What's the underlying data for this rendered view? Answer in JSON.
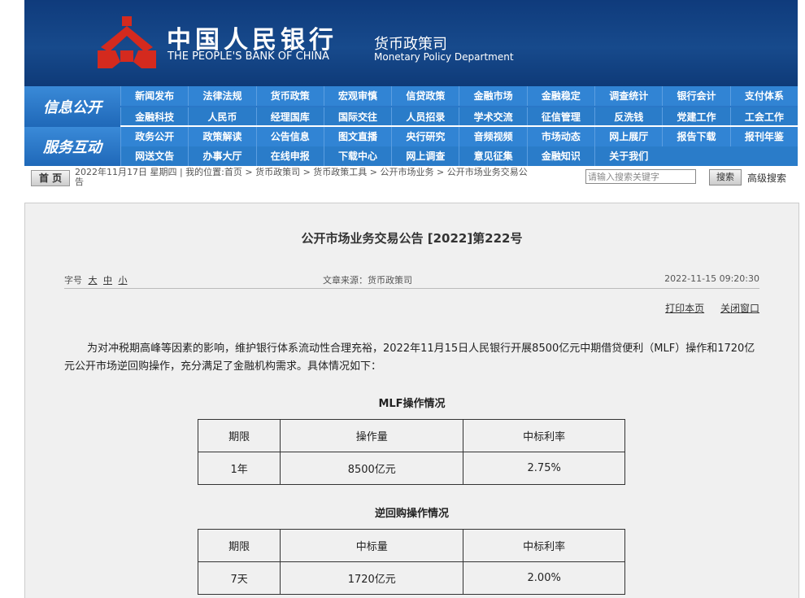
{
  "header": {
    "bank_name_cn": "中国人民银行",
    "bank_name_en": "THE PEOPLE'S BANK OF CHINA",
    "dept_cn": "货币政策司",
    "dept_en": "Monetary Policy Department"
  },
  "nav": {
    "section1_label": "信息公开",
    "section2_label": "服务互动",
    "row1": [
      "新闻发布",
      "法律法规",
      "货币政策",
      "宏观审慎",
      "信贷政策",
      "金融市场",
      "金融稳定",
      "调查统计",
      "银行会计",
      "支付体系"
    ],
    "row2": [
      "金融科技",
      "人民币",
      "经理国库",
      "国际交往",
      "人员招录",
      "学术交流",
      "征信管理",
      "反洗钱",
      "党建工作",
      "工会工作"
    ],
    "row3": [
      "政务公开",
      "政策解读",
      "公告信息",
      "图文直播",
      "央行研究",
      "音频视频",
      "市场动态",
      "网上展厅",
      "报告下载",
      "报刊年鉴"
    ],
    "row4": [
      "网送文告",
      "办事大厅",
      "在线申报",
      "下载中心",
      "网上调查",
      "意见征集",
      "金融知识",
      "关于我们"
    ]
  },
  "breadcrumb": {
    "home_label": "首 页",
    "text": "2022年11月17日 星期四 | 我的位置:首页 > 货币政策司 > 货币政策工具 > 公开市场业务 > 公开市场业务交易公告",
    "search_placeholder": "请输入搜索关键字",
    "search_button": "搜索",
    "advanced_search": "高级搜索"
  },
  "article": {
    "title": "公开市场业务交易公告 [2022]第222号",
    "font_size_label": "字号",
    "font_sizes": [
      "大",
      "中",
      "小"
    ],
    "source": "文章来源：货币政策司",
    "datetime": "2022-11-15 09:20:30",
    "print_label": "打印本页",
    "close_label": "关闭窗口",
    "paragraph": "为对冲税期高峰等因素的影响，维护银行体系流动性合理充裕，2022年11月15日人民银行开展8500亿元中期借贷便利（MLF）操作和1720亿元公开市场逆回购操作，充分满足了金融机构需求。具体情况如下：",
    "mlf_heading": "MLF操作情况",
    "mlf_table": {
      "headers": [
        "期限",
        "操作量",
        "中标利率"
      ],
      "row": [
        "1年",
        "8500亿元",
        "2.75%"
      ]
    },
    "repo_heading": "逆回购操作情况",
    "repo_table": {
      "headers": [
        "期限",
        "中标量",
        "中标利率"
      ],
      "row": [
        "7天",
        "1720亿元",
        "2.00%"
      ]
    }
  },
  "colors": {
    "banner": "#174a8c",
    "nav": "#2a78c8",
    "logo": "#d42a1e",
    "panel": "#f0f0f0"
  }
}
